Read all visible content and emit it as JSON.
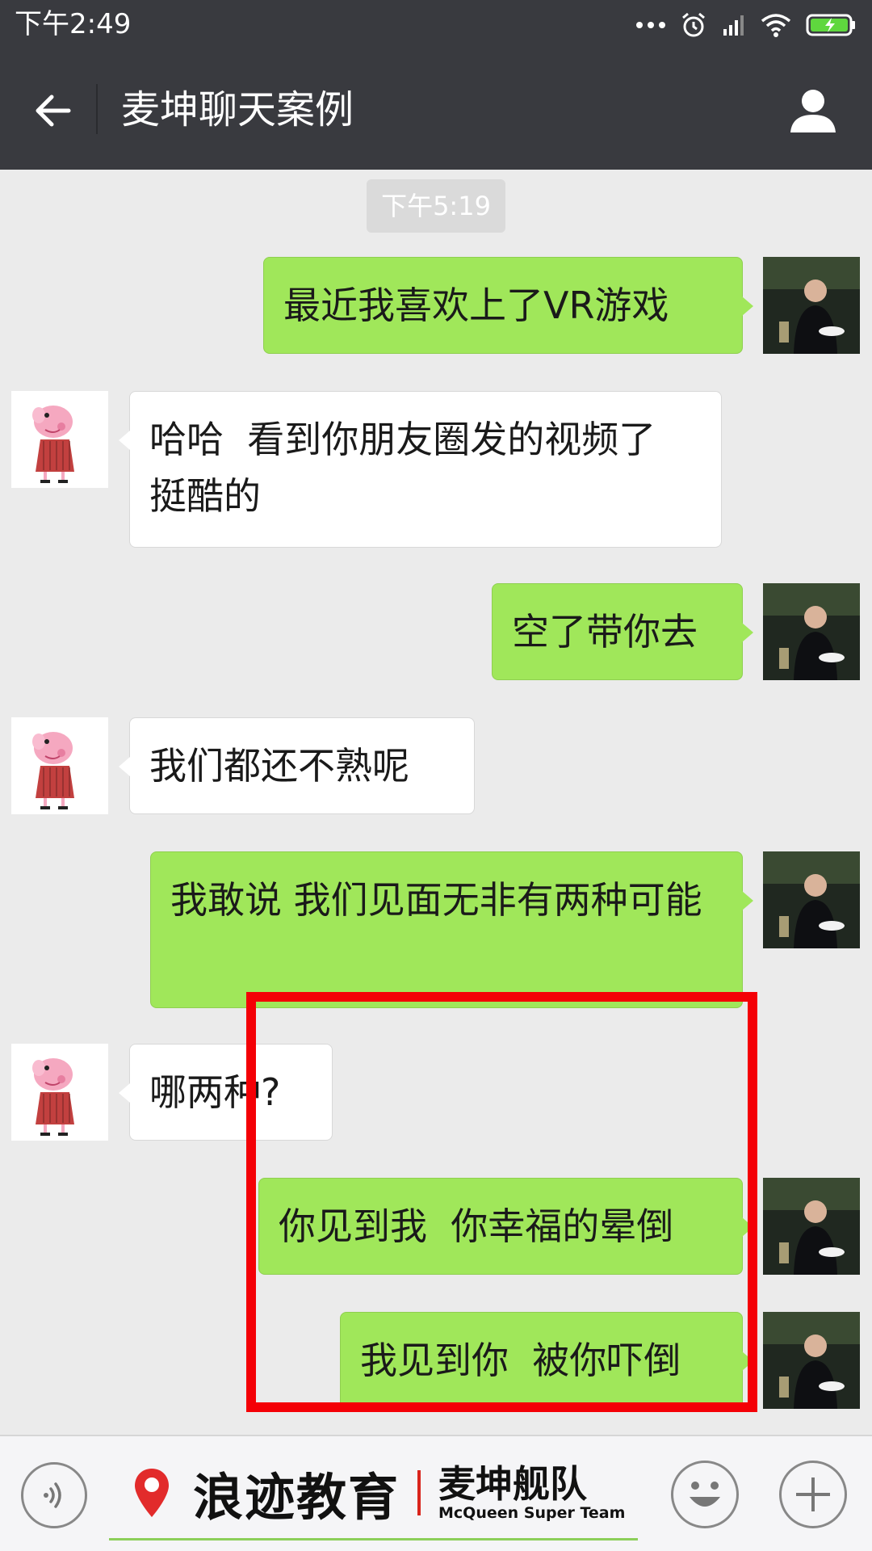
{
  "status_bar": {
    "time": "下午2:49"
  },
  "header": {
    "title": "麦坤聊天案例"
  },
  "chat": {
    "timestamp": "下午5:19",
    "messages": [
      {
        "side": "sent",
        "text": "最近我喜欢上了VR游戏"
      },
      {
        "side": "received",
        "text": "哈哈  看到你朋友圈发的视频了挺酷的"
      },
      {
        "side": "sent",
        "text": "空了带你去"
      },
      {
        "side": "received",
        "text": "我们都还不熟呢"
      },
      {
        "side": "sent",
        "text": "我敢说 我们见面无非有两种可能"
      },
      {
        "side": "received",
        "text": "哪两种?"
      },
      {
        "side": "sent",
        "text": "你见到我  你幸福的晕倒"
      },
      {
        "side": "sent",
        "text": "我见到你  被你吓倒"
      }
    ]
  },
  "bottom_bar": {
    "brand_name": "浪迹教育",
    "team_name_cn": "麦坤舰队",
    "team_name_en": "McQueen Super Team"
  },
  "colors": {
    "header_bg": "#393a3f",
    "chat_bg": "#ebebeb",
    "sent_bubble": "#a0e75a",
    "received_bubble": "#ffffff",
    "highlight": "#f40006",
    "brand_red": "#d9241c"
  }
}
